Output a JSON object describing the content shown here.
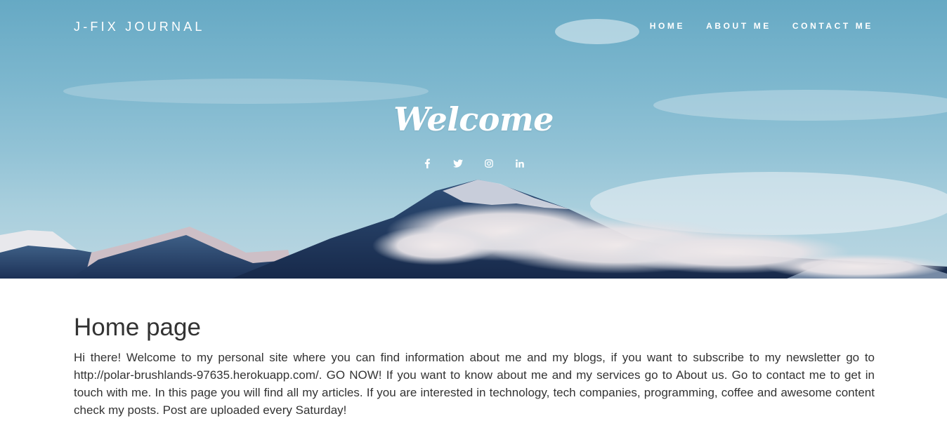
{
  "header": {
    "brand": "J-FIX JOURNAL",
    "nav": [
      {
        "label": "HOME"
      },
      {
        "label": "ABOUT ME"
      },
      {
        "label": "CONTACT ME"
      }
    ]
  },
  "hero": {
    "title": "Welcome",
    "social_icons": [
      "facebook-icon",
      "twitter-icon",
      "instagram-icon",
      "linkedin-icon"
    ]
  },
  "main": {
    "heading": "Home page",
    "body": "Hi there! Welcome to my personal site where you can find information about me and my blogs, if you want to subscribe to my newsletter go to http://polar-brushlands-97635.herokuapp.com/. GO NOW! If you want to know about me and my services go to About us. Go to contact me to get in touch with me. In this page you will find all my articles. If you are interested in technology, tech companies, programming, coffee and awesome content check my posts. Post are uploaded every Saturday!"
  },
  "colors": {
    "sky": "#7db7ce",
    "mountain_dark": "#1f3a5e",
    "text": "#333333"
  }
}
